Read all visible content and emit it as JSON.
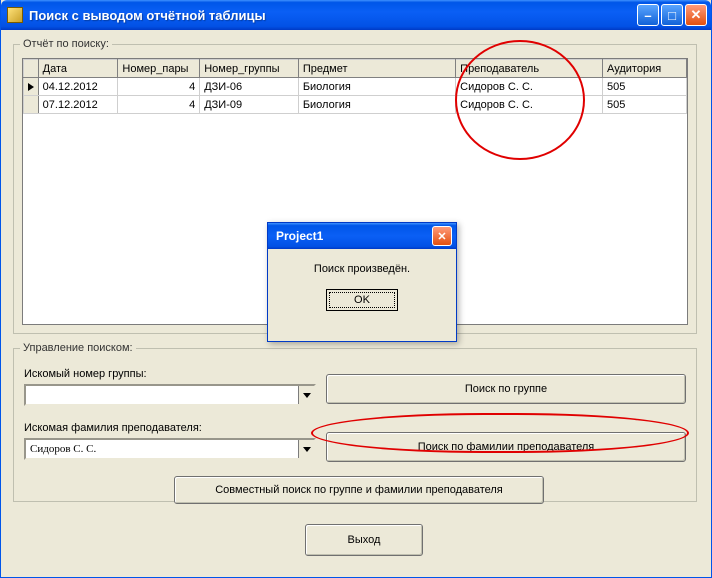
{
  "window": {
    "title": "Поиск с выводом отчётной таблицы"
  },
  "report": {
    "legend": "Отчёт по поиску:",
    "headers": {
      "date": "Дата",
      "pair": "Номер_пары",
      "group": "Номер_группы",
      "subject": "Предмет",
      "teacher": "Преподаватель",
      "room": "Аудитория"
    },
    "rows": [
      {
        "date": "04.12.2012",
        "pair": "4",
        "group": "ДЗИ-06",
        "subject": "Биология",
        "teacher": "Сидоров С. С.",
        "room": "505"
      },
      {
        "date": "07.12.2012",
        "pair": "4",
        "group": "ДЗИ-09",
        "subject": "Биология",
        "teacher": "Сидоров С. С.",
        "room": "505"
      }
    ]
  },
  "controls": {
    "legend": "Управление поиском:",
    "group_label": "Искомый номер группы:",
    "group_value": "",
    "teacher_label": "Искомая фамилия преподавателя:",
    "teacher_value": "Сидоров С. С.",
    "btn_group": "Поиск по группе",
    "btn_teacher": "Поиск по фамилии преподавателя",
    "btn_both": "Совместный поиск по группе и фамилии преподавателя"
  },
  "exit_button": "Выход",
  "dialog": {
    "title": "Project1",
    "message": "Поиск произведён.",
    "ok": "OK"
  }
}
